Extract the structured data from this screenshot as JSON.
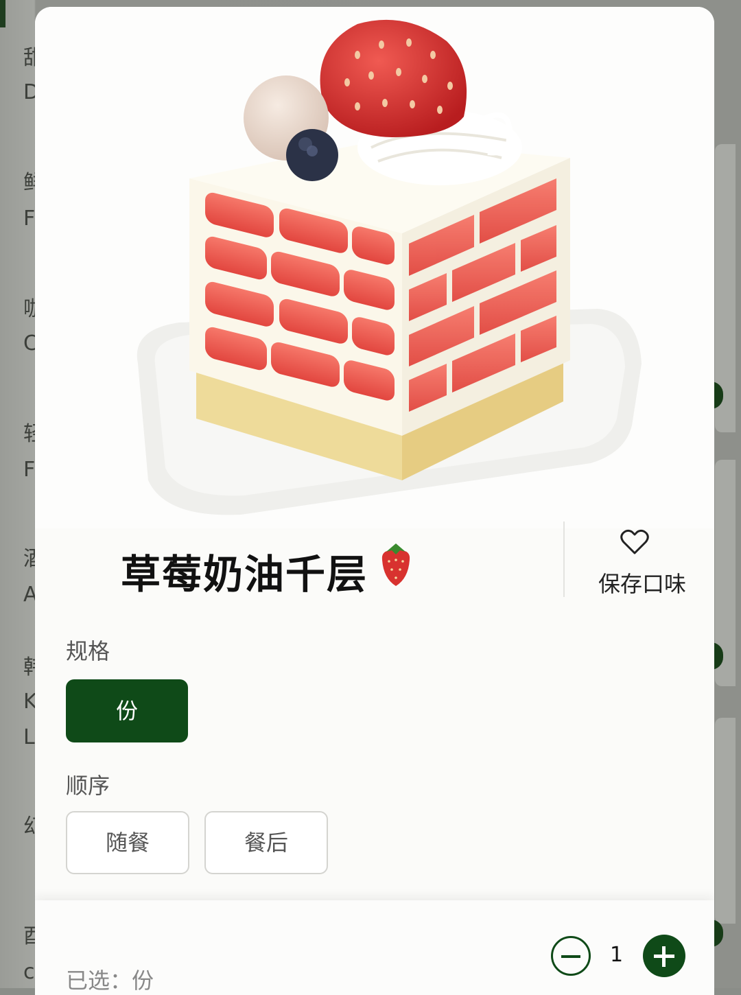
{
  "background_menu": {
    "fragments": [
      "甜",
      "D",
      "鲜",
      "F",
      "咖",
      "C",
      "轻",
      "F",
      "酒",
      "A",
      "韩",
      "K",
      "L",
      "幻",
      "酉",
      "c"
    ]
  },
  "product": {
    "name": "草莓奶油千层",
    "emoji_icon": "strawberry-icon",
    "save_label": "保存口味",
    "save_icon": "heart-outline-icon"
  },
  "spec": {
    "label": "规格",
    "options": [
      "份"
    ],
    "selected": "份"
  },
  "order": {
    "label": "顺序",
    "options": [
      "随餐",
      "餐后"
    ]
  },
  "footer": {
    "selected_text": "已选：份",
    "quantity": "1"
  },
  "colors": {
    "accent": "#0f4a18",
    "strawberry": "#d8322f",
    "cream": "#fbf7ea",
    "sponge": "#eedb9a"
  }
}
